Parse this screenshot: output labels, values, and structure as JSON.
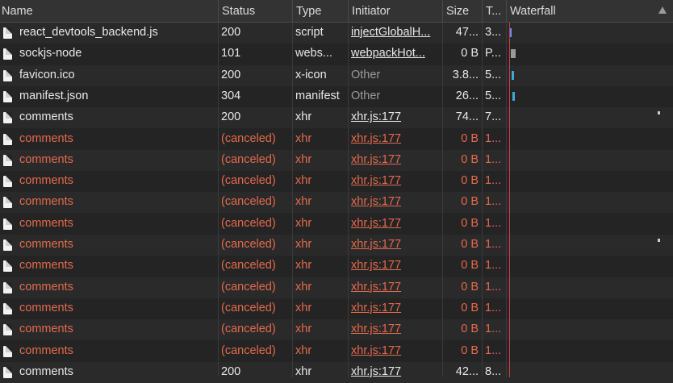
{
  "columns": {
    "name": "Name",
    "status": "Status",
    "type": "Type",
    "initiator": "Initiator",
    "size": "Size",
    "time": "T...",
    "waterfall": "Waterfall"
  },
  "colors": {
    "error": "#e46a4c",
    "waterfall_line": "#c9404a"
  },
  "rows": [
    {
      "name": "react_devtools_backend.js",
      "status": "200",
      "type": "script",
      "initiator": "injectGlobalH...",
      "initiator_link": true,
      "size": "47...",
      "time": "3...",
      "error": false
    },
    {
      "name": "sockjs-node",
      "status": "101",
      "type": "webs...",
      "initiator": "webpackHot...",
      "initiator_link": true,
      "size": "0 B",
      "time": "P...",
      "error": false
    },
    {
      "name": "favicon.ico",
      "status": "200",
      "type": "x-icon",
      "initiator": "Other",
      "initiator_link": false,
      "size": "3.8...",
      "time": "5...",
      "error": false
    },
    {
      "name": "manifest.json",
      "status": "304",
      "type": "manifest",
      "initiator": "Other",
      "initiator_link": false,
      "size": "26...",
      "time": "5...",
      "error": false
    },
    {
      "name": "comments",
      "status": "200",
      "type": "xhr",
      "initiator": "xhr.js:177",
      "initiator_link": true,
      "size": "74...",
      "time": "7...",
      "error": false
    },
    {
      "name": "comments",
      "status": "(canceled)",
      "type": "xhr",
      "initiator": "xhr.js:177",
      "initiator_link": true,
      "size": "0 B",
      "time": "1...",
      "error": true
    },
    {
      "name": "comments",
      "status": "(canceled)",
      "type": "xhr",
      "initiator": "xhr.js:177",
      "initiator_link": true,
      "size": "0 B",
      "time": "1...",
      "error": true
    },
    {
      "name": "comments",
      "status": "(canceled)",
      "type": "xhr",
      "initiator": "xhr.js:177",
      "initiator_link": true,
      "size": "0 B",
      "time": "1...",
      "error": true
    },
    {
      "name": "comments",
      "status": "(canceled)",
      "type": "xhr",
      "initiator": "xhr.js:177",
      "initiator_link": true,
      "size": "0 B",
      "time": "1...",
      "error": true
    },
    {
      "name": "comments",
      "status": "(canceled)",
      "type": "xhr",
      "initiator": "xhr.js:177",
      "initiator_link": true,
      "size": "0 B",
      "time": "1...",
      "error": true
    },
    {
      "name": "comments",
      "status": "(canceled)",
      "type": "xhr",
      "initiator": "xhr.js:177",
      "initiator_link": true,
      "size": "0 B",
      "time": "1...",
      "error": true
    },
    {
      "name": "comments",
      "status": "(canceled)",
      "type": "xhr",
      "initiator": "xhr.js:177",
      "initiator_link": true,
      "size": "0 B",
      "time": "1...",
      "error": true
    },
    {
      "name": "comments",
      "status": "(canceled)",
      "type": "xhr",
      "initiator": "xhr.js:177",
      "initiator_link": true,
      "size": "0 B",
      "time": "1...",
      "error": true
    },
    {
      "name": "comments",
      "status": "(canceled)",
      "type": "xhr",
      "initiator": "xhr.js:177",
      "initiator_link": true,
      "size": "0 B",
      "time": "1...",
      "error": true
    },
    {
      "name": "comments",
      "status": "(canceled)",
      "type": "xhr",
      "initiator": "xhr.js:177",
      "initiator_link": true,
      "size": "0 B",
      "time": "1...",
      "error": true
    },
    {
      "name": "comments",
      "status": "(canceled)",
      "type": "xhr",
      "initiator": "xhr.js:177",
      "initiator_link": true,
      "size": "0 B",
      "time": "1...",
      "error": true
    },
    {
      "name": "comments",
      "status": "200",
      "type": "xhr",
      "initiator": "xhr.js:177",
      "initiator_link": true,
      "size": "42...",
      "time": "8...",
      "error": false
    }
  ]
}
